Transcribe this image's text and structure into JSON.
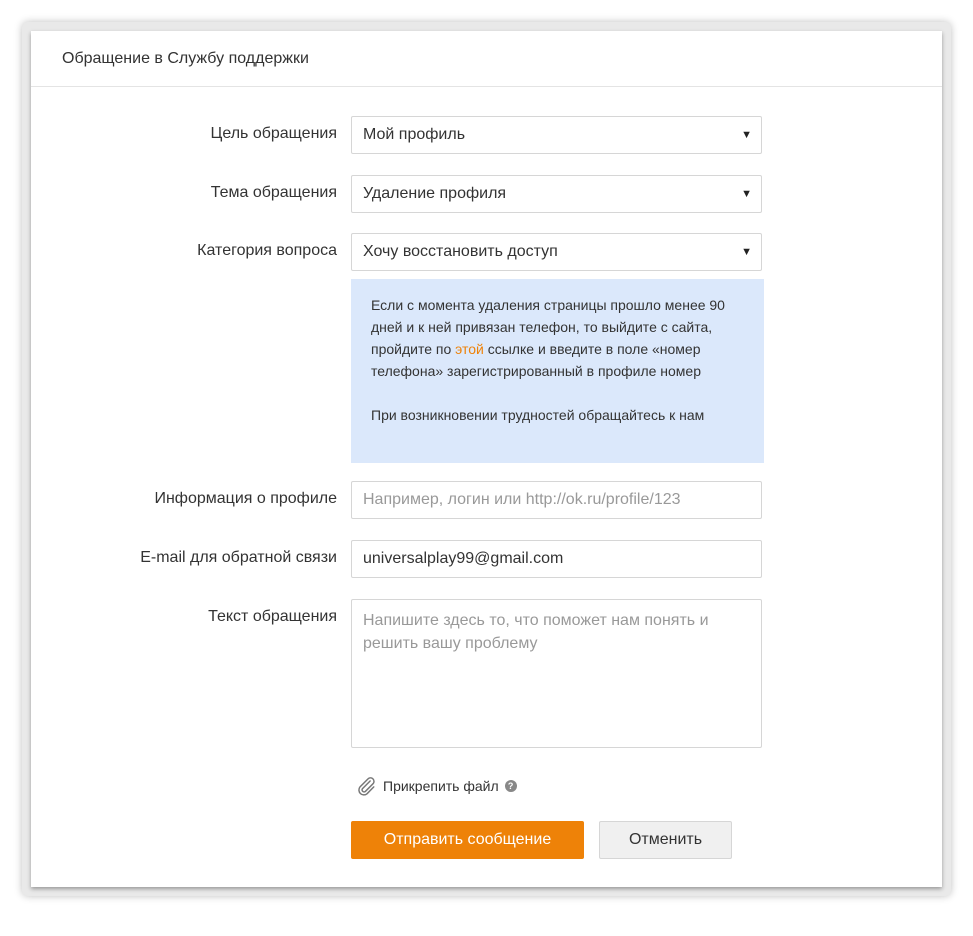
{
  "dialog": {
    "title": "Обращение в Службу поддержки"
  },
  "form": {
    "purpose": {
      "label": "Цель обращения",
      "value": "Мой профиль"
    },
    "topic": {
      "label": "Тема обращения",
      "value": "Удаление профиля"
    },
    "category": {
      "label": "Категория вопроса",
      "value": "Хочу восстановить доступ"
    },
    "info": {
      "text_before_link": "Если с момента удаления страницы прошло менее 90 дней и к ней привязан телефон, то выйдите с сайта, пройдите по ",
      "link_text": "этой",
      "text_after_link": " ссылке и введите в поле «номер телефона» зарегистрированный в профиле номер",
      "note": "При возникновении трудностей обращайтесь к нам"
    },
    "profile_info": {
      "label": "Информация о профиле",
      "placeholder": "Например, логин или http://ok.ru/profile/123"
    },
    "email": {
      "label": "E-mail для обратной связи",
      "value": "universalplay99@gmail.com"
    },
    "message": {
      "label": "Текст обращения",
      "placeholder": "Напишите здесь то, что поможет нам понять и решить вашу проблему"
    },
    "attach_label": "Прикрепить файл",
    "help_glyph": "?",
    "submit_label": "Отправить сообщение",
    "cancel_label": "Отменить"
  },
  "icons": {
    "select_arrow": "▼",
    "attach": "paperclip-icon",
    "help": "help-icon"
  },
  "colors": {
    "accent": "#ee8208",
    "info_bg": "#dbe8fb"
  }
}
